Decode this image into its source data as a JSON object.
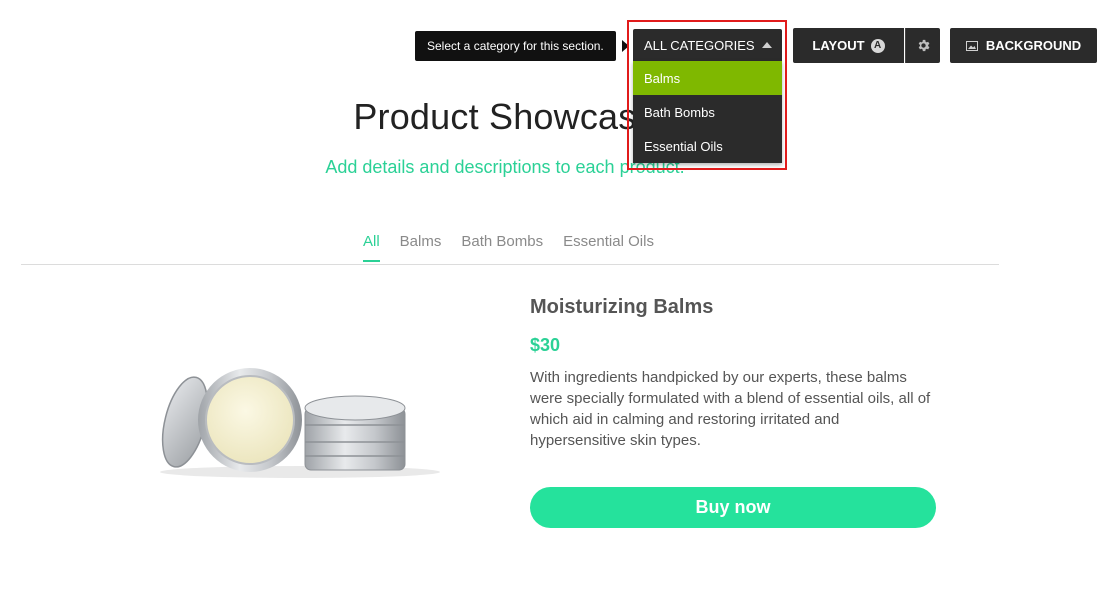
{
  "toolbar": {
    "tooltip_text": "Select a category for this section.",
    "category_select": {
      "selected": "ALL CATEGORIES",
      "options": [
        "Balms",
        "Bath Bombs",
        "Essential Oils"
      ],
      "highlighted_option": "Balms"
    },
    "layout_label": "LAYOUT",
    "layout_badge": "A",
    "background_label": "BACKGROUND"
  },
  "section": {
    "title": "Product Showcase",
    "subtitle": "Add details and descriptions to each product."
  },
  "tabs": [
    {
      "label": "All",
      "active": true
    },
    {
      "label": "Balms",
      "active": false
    },
    {
      "label": "Bath Bombs",
      "active": false
    },
    {
      "label": "Essential Oils",
      "active": false
    }
  ],
  "product": {
    "name": "Moisturizing Balms",
    "price": "$30",
    "description": "With ingredients handpicked by our experts, these balms were specially formulated with a blend of essential oils, all of which aid in calming and restoring irritated and hypersensitive skin types.",
    "buy_label": "Buy now"
  },
  "colors": {
    "accent": "#2bd196",
    "button": "#25e29c",
    "toolbar": "#2b2b2b",
    "selected_option": "#7fb800",
    "highlight": "#e11b1b"
  }
}
